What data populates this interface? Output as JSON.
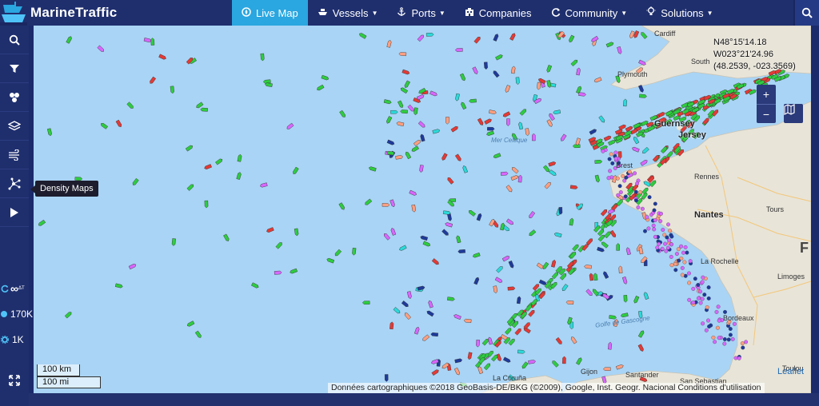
{
  "app": {
    "name": "MarineTraffic"
  },
  "nav": [
    {
      "label": "Live Map",
      "icon": "compass-icon",
      "active": true,
      "dropdown": false
    },
    {
      "label": "Vessels",
      "icon": "ship-icon",
      "dropdown": true
    },
    {
      "label": "Ports",
      "icon": "anchor-icon",
      "dropdown": true
    },
    {
      "label": "Companies",
      "icon": "building-icon",
      "dropdown": false
    },
    {
      "label": "Community",
      "icon": "refresh-icon",
      "dropdown": true
    },
    {
      "label": "Solutions",
      "icon": "lightbulb-icon",
      "dropdown": true
    }
  ],
  "sidebar": {
    "tools": [
      "search-icon",
      "filter-icon",
      "vessel-group-icon",
      "layers-icon",
      "weather-icon",
      "density-maps-icon",
      "play-icon"
    ],
    "tooltip": "Density Maps",
    "stats": [
      {
        "label": "∞",
        "sup": "ΔT"
      },
      {
        "label": "170K"
      },
      {
        "label": "1K"
      }
    ]
  },
  "map": {
    "coords": {
      "lat": "N48°15'14.18",
      "lon": "W023°21'24.96",
      "decimal": "(48.2539, -023.3569)"
    },
    "zoom_in": "+",
    "zoom_out": "−",
    "places": {
      "cardiff": "Cardiff",
      "south": "South",
      "plymouth": "Plymouth",
      "guernsey": "Guernsey",
      "jersey": "Jersey",
      "brest": "Brest",
      "rennes": "Rennes",
      "nantes": "Nantes",
      "tours": "Tours",
      "la_rochelle": "La Rochelle",
      "limoges": "Limoges",
      "bordeaux": "Bordeaux",
      "gijon": "Gijon",
      "santander": "Santander",
      "san_sebastian": "San Sebastian",
      "la_coruna": "La Coruña",
      "toulouse": "Toulou",
      "france": "F"
    },
    "seas": {
      "celtic": "Mer Celtique",
      "gascogne": "Golfe de Gascogne"
    },
    "scale_km": "100 km",
    "scale_mi": "100 mi",
    "leaflet": "Leaflet",
    "attribution": "Données cartographiques ©2018 GeoBasis-DE/BKG (©2009), Google, Inst. Geogr. Nacional   Conditions d'utilisation"
  },
  "colors": {
    "sea": "#a9d4f5",
    "land": "#e8e4d8",
    "topbar": "#1f2f6e",
    "active": "#2aa6e0",
    "cargo": "#2ecc40",
    "tanker": "#e53935",
    "fishing": "#ff9f80",
    "passenger": "#1e3a9a",
    "pleasure": "#d966ff",
    "tug": "#2bd9d9"
  }
}
